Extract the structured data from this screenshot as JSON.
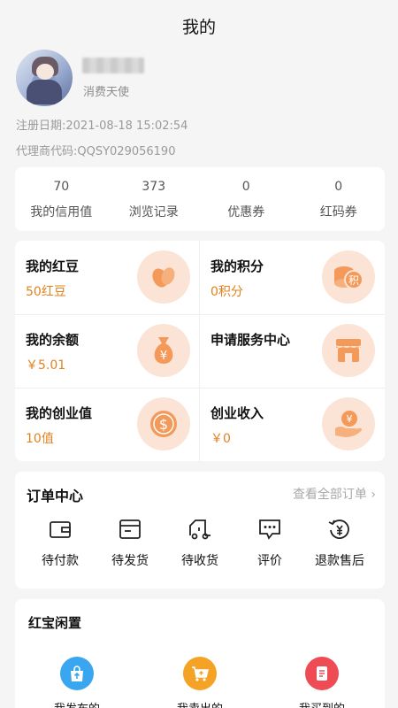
{
  "page": {
    "title": "我的"
  },
  "user": {
    "level": "消费天使",
    "register_date": "注册日期:2021-08-18 15:02:54",
    "agent_code": "代理商代码:QQSY029056190"
  },
  "stats": [
    {
      "value": "70",
      "label": "我的信用值"
    },
    {
      "value": "373",
      "label": "浏览记录"
    },
    {
      "value": "0",
      "label": "优惠券"
    },
    {
      "value": "0",
      "label": "红码券"
    }
  ],
  "assets": [
    {
      "title": "我的红豆",
      "value": "50红豆",
      "icon": "bean-icon"
    },
    {
      "title": "我的积分",
      "value": "0积分",
      "icon": "points-coins-icon",
      "icon_text": "积"
    },
    {
      "title": "我的余额",
      "value": "￥5.01",
      "icon": "money-bag-icon",
      "icon_text": "¥"
    },
    {
      "title": "申请服务中心",
      "value": "",
      "icon": "shop-icon"
    },
    {
      "title": "我的创业值",
      "value": "10值",
      "icon": "dollar-coin-icon",
      "icon_text": "$"
    },
    {
      "title": "创业收入",
      "value": "￥0",
      "icon": "income-hand-icon",
      "icon_text": "¥"
    }
  ],
  "orders": {
    "title": "订单中心",
    "view_all": "查看全部订单 ›",
    "items": [
      {
        "label": "待付款",
        "icon": "wallet-icon"
      },
      {
        "label": "待发货",
        "icon": "package-box-icon"
      },
      {
        "label": "待收货",
        "icon": "truck-icon"
      },
      {
        "label": "评价",
        "icon": "comment-icon"
      },
      {
        "label": "退款售后",
        "icon": "refund-icon"
      }
    ]
  },
  "idle": {
    "title": "红宝闲置",
    "items": [
      {
        "label": "我发布的",
        "icon": "bag-upload-icon",
        "color": "#3aa6f0"
      },
      {
        "label": "我卖出的",
        "icon": "cart-icon",
        "color": "#f5a326"
      },
      {
        "label": "我买到的",
        "icon": "receipt-icon",
        "color": "#ef4b55"
      }
    ]
  },
  "colors": {
    "accent": "#e0831f",
    "icon_bg": "#fbe4d6",
    "icon_fg": "#f39a5b"
  }
}
